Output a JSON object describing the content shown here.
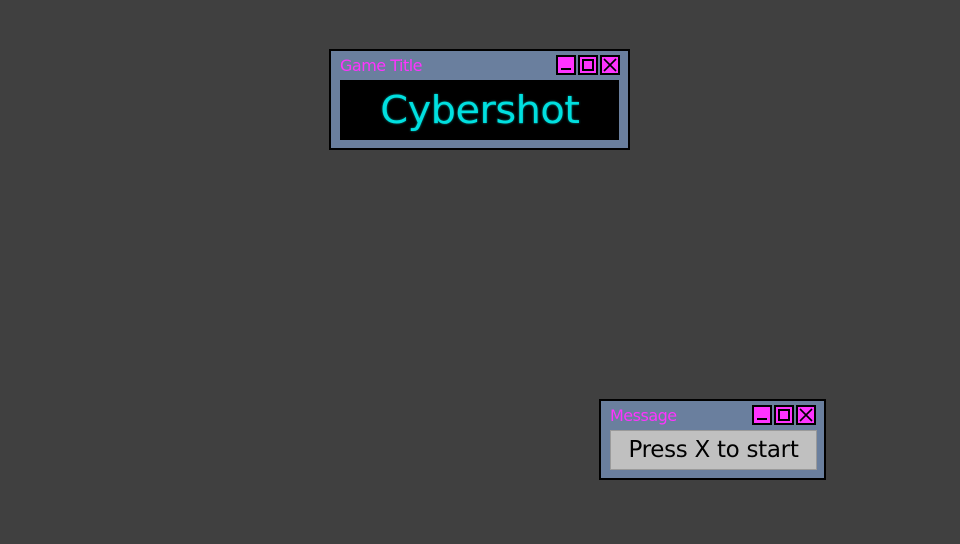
{
  "colors": {
    "background": "#404040",
    "window_fill": "#6a7f9e",
    "window_title": "#ff33ff",
    "control_fill": "#ff33ff",
    "game_title_text": "#00e0e0",
    "message_panel": "#c0c0c0"
  },
  "title_window": {
    "title": "Game Title",
    "game_name": "Cybershot",
    "controls": [
      "minimize-icon",
      "maximize-icon",
      "close-icon"
    ]
  },
  "message_window": {
    "title": "Message",
    "text": "Press X to start",
    "controls": [
      "minimize-icon",
      "maximize-icon",
      "close-icon"
    ]
  }
}
